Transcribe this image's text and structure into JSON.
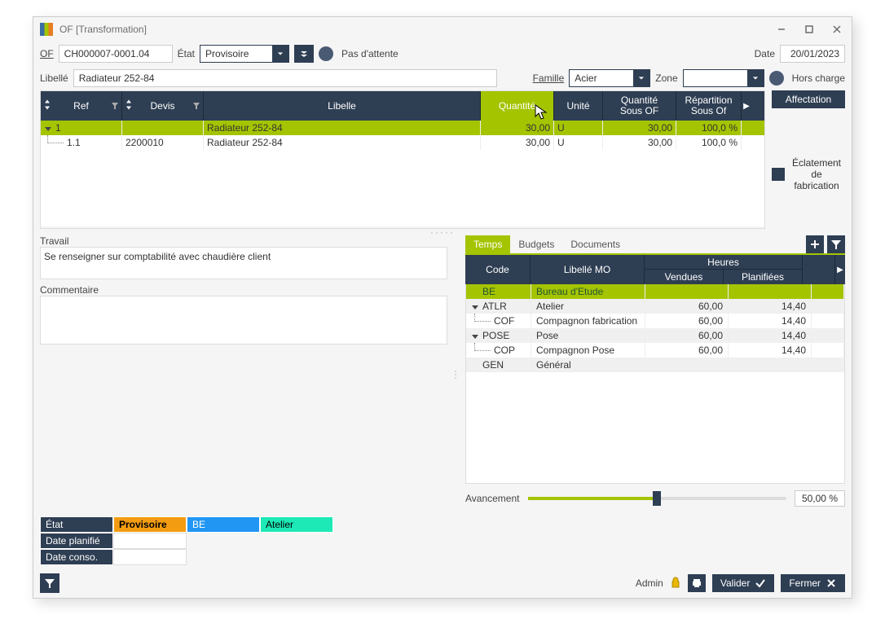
{
  "window": {
    "title": "OF [Transformation]"
  },
  "toolbar": {
    "of_label": "OF",
    "of_value": "CH000007-0001.04",
    "etat_label": "État",
    "etat_value": "Provisoire",
    "attente_text": "Pas d'attente",
    "date_label": "Date",
    "date_value": "20/01/2023"
  },
  "row2": {
    "libelle_label": "Libellé",
    "libelle_value": "Radiateur 252-84",
    "famille_label": "Famille",
    "famille_value": "Acier",
    "zone_label": "Zone",
    "zone_value": "",
    "hors_charge": "Hors charge"
  },
  "grid": {
    "headers": {
      "ref": "Ref",
      "devis": "Devis",
      "libelle": "Libelle",
      "quantite": "Quantité",
      "unite": "Unité",
      "quantite_sous_of_1": "Quantité",
      "quantite_sous_of_2": "Sous OF",
      "repartition_1": "Répartition",
      "repartition_2": "Sous Of"
    },
    "rows": [
      {
        "ref": "1",
        "devis": "",
        "libelle": "Radiateur 252-84",
        "quantite": "30,00",
        "unite": "U",
        "q_sous": "30,00",
        "rep": "100,0 %"
      },
      {
        "ref": "1.1",
        "devis": "2200010",
        "libelle": "Radiateur 252-84",
        "quantite": "30,00",
        "unite": "U",
        "q_sous": "30,00",
        "rep": "100,0 %"
      }
    ]
  },
  "right": {
    "affectation": "Affectation",
    "eclatement": "Éclatement de fabrication"
  },
  "travail": {
    "label": "Travail",
    "text": "Se renseigner sur comptabilité avec chaudière client",
    "comment_label": "Commentaire"
  },
  "tabs": {
    "temps": "Temps",
    "budgets": "Budgets",
    "documents": "Documents"
  },
  "subgrid": {
    "headers": {
      "code": "Code",
      "libelle_mo": "Libellé MO",
      "heures": "Heures",
      "vendues": "Vendues",
      "planifiees": "Planifiées"
    },
    "rows": [
      {
        "code": "BE",
        "label": "Bureau d'Etude",
        "vendues": "",
        "plan": "",
        "style": "green",
        "indent": 0
      },
      {
        "code": "ATLR",
        "label": "Atelier",
        "vendues": "60,00",
        "plan": "14,40",
        "style": "alt",
        "indent": 0,
        "caret": true
      },
      {
        "code": "COF",
        "label": "Compagnon fabrication",
        "vendues": "60,00",
        "plan": "14,40",
        "style": "",
        "indent": 1
      },
      {
        "code": "POSE",
        "label": "Pose",
        "vendues": "60,00",
        "plan": "14,40",
        "style": "alt",
        "indent": 0,
        "caret": true
      },
      {
        "code": "COP",
        "label": "Compagnon Pose",
        "vendues": "60,00",
        "plan": "14,40",
        "style": "",
        "indent": 1
      },
      {
        "code": "GEN",
        "label": "Général",
        "vendues": "",
        "plan": "",
        "style": "alt",
        "indent": 0
      }
    ]
  },
  "avancement": {
    "label": "Avancement",
    "pct": "50,00 %",
    "pct_num": 50
  },
  "bottom": {
    "etat": "État",
    "provisoire": "Provisoire",
    "be": "BE",
    "atelier": "Atelier",
    "date_planifie": "Date planifié",
    "date_conso": "Date conso."
  },
  "footer": {
    "admin": "Admin",
    "valider": "Valider",
    "fermer": "Fermer"
  }
}
